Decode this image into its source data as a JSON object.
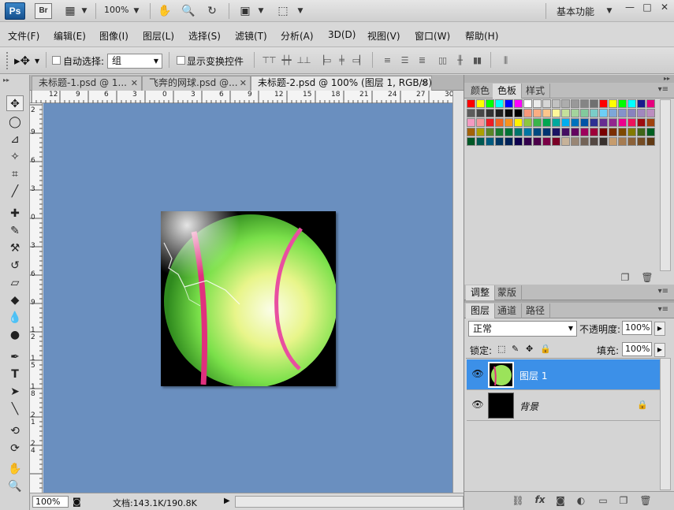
{
  "app": {
    "logo": "Ps",
    "bridge": "Br",
    "zoom": "100%",
    "workspace": "基本功能"
  },
  "menu": [
    "文件(F)",
    "编辑(E)",
    "图像(I)",
    "图层(L)",
    "选择(S)",
    "滤镜(T)",
    "分析(A)",
    "3D(D)",
    "视图(V)",
    "窗口(W)",
    "帮助(H)"
  ],
  "options": {
    "auto_select_label": "自动选择:",
    "auto_select_value": "组",
    "show_transform_label": "显示变换控件"
  },
  "tabs": [
    {
      "label": "未标题-1.psd @ 1..."
    },
    {
      "label": "飞奔的网球.psd @..."
    },
    {
      "label": "未标题-2.psd @ 100% (图层 1, RGB/8)"
    }
  ],
  "ruler_top": [
    "12",
    "9",
    "6",
    "3",
    "0",
    "3",
    "6",
    "9",
    "12",
    "15",
    "18",
    "21",
    "24",
    "27",
    "30"
  ],
  "ruler_left": [
    "2",
    "9",
    "6",
    "3",
    "0",
    "3",
    "6",
    "9",
    "1\n2",
    "1\n5",
    "1\n8",
    "2\n1",
    "2\n4"
  ],
  "status": {
    "zoom": "100%",
    "doc_info": "文档:143.1K/190.8K"
  },
  "panels": {
    "top_tabs": [
      "颜色",
      "色板",
      "样式"
    ],
    "mid_tabs": [
      "调整",
      "蒙版"
    ],
    "layer_tabs": [
      "图层",
      "通道",
      "路径"
    ],
    "blend_mode": "正常",
    "opacity_label": "不透明度:",
    "opacity": "100%",
    "lock_label": "锁定:",
    "fill_label": "填充:",
    "fill": "100%",
    "layers": [
      {
        "name": "图层 1",
        "selected": true
      },
      {
        "name": "背景",
        "selected": false,
        "locked": true
      }
    ]
  },
  "swatch_colors": [
    "#ff0000",
    "#ffff00",
    "#00ff00",
    "#00ffff",
    "#0000ff",
    "#ff00ff",
    "#ffffff",
    "#ebebeb",
    "#d6d6d6",
    "#c2c2c2",
    "#adadad",
    "#999999",
    "#858585",
    "#707070",
    "#ff0000",
    "#ffff00",
    "#00ff00",
    "#00ffff",
    "#1a1a8c",
    "#e6007e",
    "#5c5c5c",
    "#474747",
    "#333333",
    "#1f1f1f",
    "#0a0a0a",
    "#000000",
    "#f7977a",
    "#fbad82",
    "#fdc68c",
    "#fff79a",
    "#c4df9b",
    "#a3d39c",
    "#82ca9c",
    "#7accc8",
    "#6dcff6",
    "#7da7d8",
    "#8493ca",
    "#8882be",
    "#a187be",
    "#bc8dbf",
    "#f49ac2",
    "#f6989d",
    "#ed1c24",
    "#f26522",
    "#f7941d",
    "#fff200",
    "#8dc63f",
    "#39b54a",
    "#00a651",
    "#00a99d",
    "#00aeef",
    "#0072bc",
    "#0054a6",
    "#2e3192",
    "#662d91",
    "#92278f",
    "#ec008c",
    "#ed145b",
    "#9e0b0f",
    "#a0410d",
    "#a36209",
    "#aba000",
    "#598527",
    "#197b30",
    "#007236",
    "#00746b",
    "#0076a3",
    "#004a80",
    "#003471",
    "#1b1464",
    "#440e62",
    "#630460",
    "#9e005d",
    "#9e0039",
    "#790000",
    "#7b2e00",
    "#7d4900",
    "#827b00",
    "#406618",
    "#005e20",
    "#005826",
    "#005952",
    "#005b7f",
    "#003663",
    "#002157",
    "#0d004c",
    "#32004b",
    "#4b0049",
    "#7b0046",
    "#7a0026",
    "#c7b299",
    "#998675",
    "#736357",
    "#534741",
    "#37302d",
    "#c69c6d",
    "#a67c52",
    "#8c6239",
    "#754c24",
    "#603913"
  ]
}
